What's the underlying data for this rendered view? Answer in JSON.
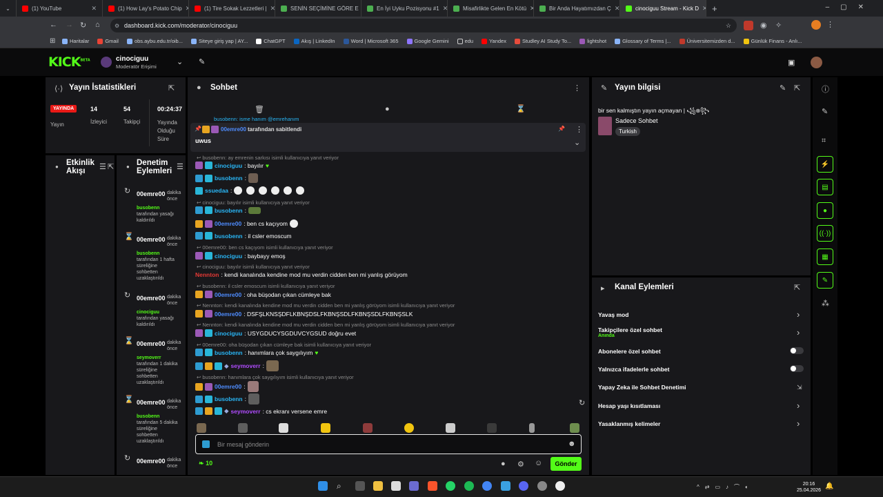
{
  "browser": {
    "tabs": [
      {
        "label": "(1) YouTube",
        "color": "#ff0000"
      },
      {
        "label": "(1) How Lay's Potato Chip",
        "color": "#ff0000"
      },
      {
        "label": "(1) Tire Sokak Lezzetleri |",
        "color": "#ff0000"
      },
      {
        "label": "SENİN SEÇİMİNE GÖRE E",
        "color": "#4caf50"
      },
      {
        "label": "En İyi Uyku Pozisyonu #1",
        "color": "#4caf50"
      },
      {
        "label": "Misafirlikte Gelen En Kötü",
        "color": "#4caf50"
      },
      {
        "label": "Bir Anda Hayatımızdan Ç",
        "color": "#4caf50"
      },
      {
        "label": "cinociguu Stream - Kick D",
        "color": "#53fc18"
      }
    ],
    "url": "dashboard.kick.com/moderator/cinociguu",
    "bookmarks": [
      "Haritalar",
      "Gmail",
      "obs.aybu.edu.tr/oib...",
      "Siteye giriş yap | AY...",
      "ChatGPT",
      "Akış | LinkedIn",
      "Word | Microsoft 365",
      "Google Gemini",
      "edu",
      "Yandex",
      "Studley AI Study To...",
      "lightshot",
      "Glossary of Terms |...",
      "Üniversitemizden d...",
      "Günlük Finans - Anlı..."
    ]
  },
  "header": {
    "logo": "KICK",
    "logo_sup": "BETA",
    "channel": "cinociguu",
    "role": "Moderatör Erişimi"
  },
  "stats": {
    "title": "Yayın İstatistikleri",
    "live_badge": "YAYINDA",
    "live_label": "Yayın",
    "viewers_value": "14",
    "viewers_label": "İzleyici",
    "followers_value": "54",
    "followers_label": "Takipçi",
    "duration_value": "00:24:37",
    "duration_label": "Yayında Olduğu Süre"
  },
  "activity": {
    "title": "Etkinlik Akışı"
  },
  "mod_actions": {
    "title": "Denetim Eylemleri",
    "items": [
      {
        "user": "00emre00",
        "time": "dakika önce",
        "actor": "busobenn",
        "text": "tarafından yasağı kaldırıldı"
      },
      {
        "user": "00emre00",
        "time": "dakika önce",
        "actor": "busobenn",
        "text": "tarafından 1 hafta süreliğine sohbetten uzaklaştırıldı"
      },
      {
        "user": "00emre00",
        "time": "dakika önce",
        "actor": "cinociguu",
        "text": "tarafından yasağı kaldırıldı"
      },
      {
        "user": "00emre00",
        "time": "dakika önce",
        "actor": "seymoverr",
        "text": "tarafından 1 dakika süreliğine sohbetten uzaklaştırıldı"
      },
      {
        "user": "00emre00",
        "time": "dakika önce",
        "actor": "busobenn",
        "text": "tarafından 5 dakika süreliğine sohbetten uzaklaştırıldı"
      },
      {
        "user": "00emre00",
        "time": "dakika önce",
        "actor": "",
        "text": ""
      }
    ]
  },
  "chat": {
    "title": "Sohbet",
    "top_partial": "busobenn: isme hanım @emrehanım",
    "pinned_by": "00emre00",
    "pinned_suffix": "tarafından sabitlendi",
    "pinned_message": "uwus",
    "messages": [
      {
        "reply": "busobenn: ay emrenin sarkısı isimli kullanıcıya yanıt veriyor",
        "user": "cinociguu",
        "text": ": bayılır",
        "color": "#29b6f6"
      },
      {
        "reply": "",
        "user": "busobenn",
        "text": ":",
        "color": "#29b6f6"
      },
      {
        "reply": "",
        "user": "ssuedaa",
        "text": ":",
        "color": "#29b6f6"
      },
      {
        "reply": "cinociguu: bayılır isimli kullanıcıya yanıt veriyor",
        "user": "busobenn",
        "text": ":",
        "color": "#29b6f6"
      },
      {
        "reply": "",
        "user": "00emre00",
        "text": ": ben cs kaçıyom",
        "color": "#4e8cff"
      },
      {
        "reply": "",
        "user": "busobenn",
        "text": ": il csler emoscum",
        "color": "#29b6f6"
      },
      {
        "reply": "00emre00: ben cs kaçıyom isimli kullanıcıya yanıt veriyor",
        "user": "cinociguu",
        "text": ": baybayy emoş",
        "color": "#29b6f6"
      },
      {
        "reply": "cinociguu: bayılır isimli kullanıcıya yanıt veriyor",
        "user": "Nennton",
        "text": ": kendi kanalında kendine mod mu verdin cidden ben mi yanlış görüyom",
        "color": "#e53935"
      },
      {
        "reply": "busobenn: il csler emoscum isimli kullanıcıya yanıt veriyor",
        "user": "00emre00",
        "text": ": oha büşodan çıkan cümleye bak",
        "color": "#4e8cff"
      },
      {
        "reply": "Nennton: kendi kanalında kendine mod mu verdin cidden ben mi yanlış görüyom isimli kullanıcıya yanıt veriyor",
        "user": "00emre00",
        "text": ": DSFŞLKNSŞDFLKBNŞDSLFKBNŞSDLFKBNŞSDLFKBNŞSLK",
        "color": "#4e8cff"
      },
      {
        "reply": "Nennton: kendi kanalında kendine mod mu verdin cidden ben mi yanlış görüyom isimli kullanıcıya yanıt veriyor",
        "user": "cinociguu",
        "text": ": USYGDUCYSGDUVCYGSUD doğru evet",
        "color": "#29b6f6"
      },
      {
        "reply": "00emre00: oha büşodan çıkan cümleye bak isimli kullanıcıya yanıt veriyor",
        "user": "busobenn",
        "text": ": hanımlara çok saygılıyım",
        "color": "#29b6f6"
      },
      {
        "reply": "",
        "user": "seymoverr",
        "text": ":",
        "color": "#b04cff"
      },
      {
        "reply": "busobenn: hanımlara çok saygılıyım isimli kullanıcıya yanıt veriyor",
        "user": "00emre00",
        "text": ":",
        "color": "#4e8cff"
      },
      {
        "reply": "",
        "user": "busobenn",
        "text": ":",
        "color": "#29b6f6"
      },
      {
        "reply": "",
        "user": "seymoverr",
        "text": ": cs ekranı versene emre",
        "color": "#b04cff"
      }
    ],
    "placeholder": "Bir mesaj gönderin",
    "points": "10",
    "send_label": "Gönder"
  },
  "stream_info": {
    "title": "Yayın bilgisi",
    "stream_title": "bir sen kalmıştın yayın açmayan | ꧁᪥꧂",
    "category": "Sadece Sohbet",
    "language": "Turkish"
  },
  "channel_actions": {
    "title": "Kanal Eylemleri",
    "items": [
      {
        "label": "Yavaş mod",
        "control": "chevron"
      },
      {
        "label": "Takipçilere özel sohbet",
        "sub": "Anında",
        "control": "chevron"
      },
      {
        "label": "Abonelere özel sohbet",
        "control": "toggle"
      },
      {
        "label": "Yalnızca ifadelerle sohbet",
        "control": "toggle"
      },
      {
        "label": "Yapay Zeka ile Sohbet Denetimi",
        "control": "external"
      },
      {
        "label": "Hesap yaşı kısıtlaması",
        "control": "chevron"
      },
      {
        "label": "Yasaklanmış kelimeler",
        "control": "chevron"
      }
    ]
  },
  "taskbar": {
    "time": "20:16",
    "date": "25.04.2026"
  },
  "colors": {
    "accent": "#53fc18",
    "panel": "#18181b",
    "live": "#e91916"
  }
}
